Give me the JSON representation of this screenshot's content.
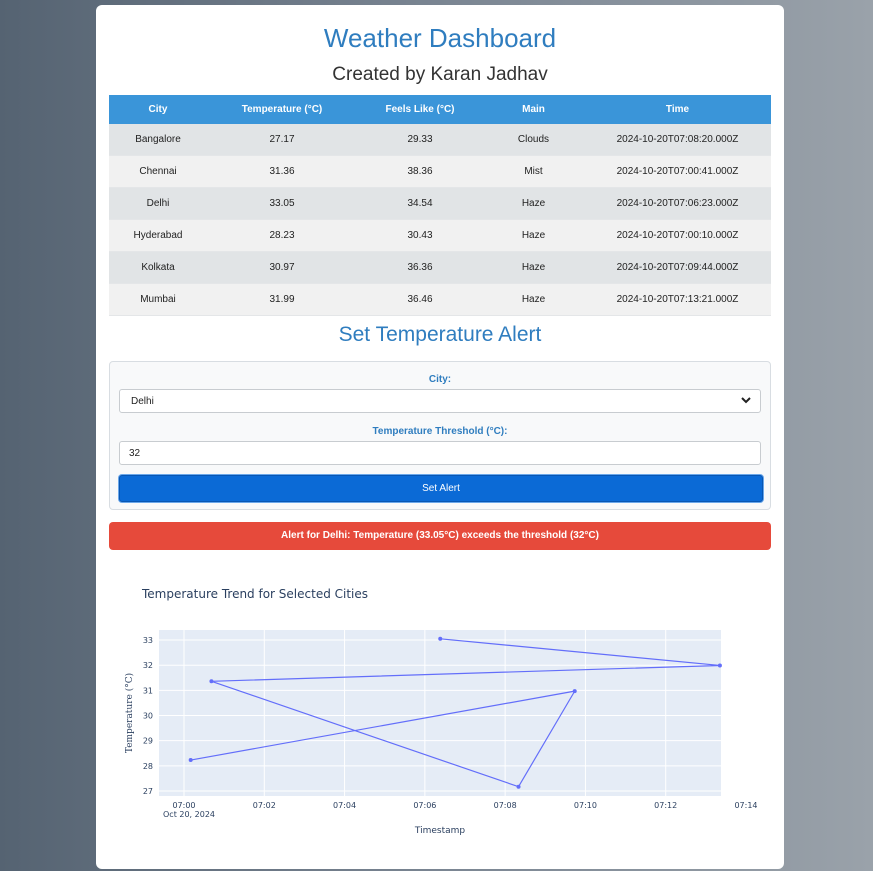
{
  "header": {
    "title": "Weather Dashboard",
    "subtitle": "Created by Karan Jadhav"
  },
  "table": {
    "columns": [
      "City",
      "Temperature (°C)",
      "Feels Like (°C)",
      "Main",
      "Time"
    ],
    "rows": [
      [
        "Bangalore",
        "27.17",
        "29.33",
        "Clouds",
        "2024-10-20T07:08:20.000Z"
      ],
      [
        "Chennai",
        "31.36",
        "38.36",
        "Mist",
        "2024-10-20T07:00:41.000Z"
      ],
      [
        "Delhi",
        "33.05",
        "34.54",
        "Haze",
        "2024-10-20T07:06:23.000Z"
      ],
      [
        "Hyderabad",
        "28.23",
        "30.43",
        "Haze",
        "2024-10-20T07:00:10.000Z"
      ],
      [
        "Kolkata",
        "30.97",
        "36.36",
        "Haze",
        "2024-10-20T07:09:44.000Z"
      ],
      [
        "Mumbai",
        "31.99",
        "36.46",
        "Haze",
        "2024-10-20T07:13:21.000Z"
      ]
    ]
  },
  "alert_form": {
    "heading": "Set Temperature Alert",
    "city_label": "City:",
    "city_value": "Delhi",
    "threshold_label": "Temperature Threshold (°C):",
    "threshold_value": "32",
    "button_label": "Set Alert"
  },
  "alert_message": "Alert for Delhi: Temperature (33.05°C) exceeds the threshold (32°C)",
  "colors": {
    "accent": "#2f7dbf",
    "table_header": "#3a95d9",
    "button": "#0b6ad6",
    "alert": "#e64a3b",
    "series": "#636efa",
    "plot_bg": "#e5ecf6"
  },
  "chart_data": {
    "type": "line",
    "title": "Temperature Trend for Selected Cities",
    "xlabel": "Timestamp",
    "ylabel": "Temperature (°C)",
    "x_ticks": [
      "07:00",
      "07:02",
      "07:04",
      "07:06",
      "07:08",
      "07:10",
      "07:12",
      "07:14"
    ],
    "x_tick_date": "Oct 20, 2024",
    "y_ticks": [
      "27",
      "28",
      "29",
      "30",
      "31",
      "32",
      "33"
    ],
    "xlim": [
      "07:00:00",
      "07:14:00"
    ],
    "ylim": [
      26.8,
      33.4
    ],
    "grid": true,
    "x": [
      "07:06:23",
      "07:13:21",
      "07:00:41",
      "07:08:20",
      "07:09:44",
      "07:00:10"
    ],
    "y": [
      33.05,
      31.99,
      31.36,
      27.17,
      30.97,
      28.23
    ]
  }
}
